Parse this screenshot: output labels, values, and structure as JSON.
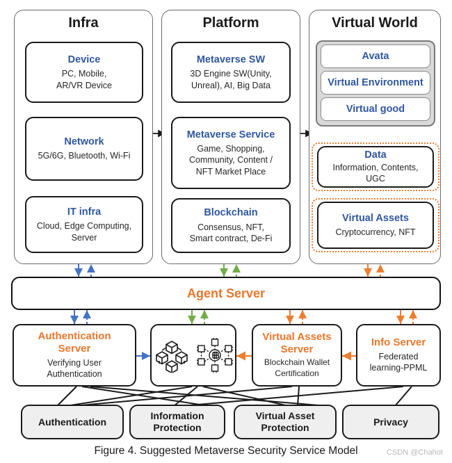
{
  "figure": {
    "caption": "Figure 4. Suggested Metaverse Security Service Model",
    "watermark": "CSDN @Chahot"
  },
  "colors": {
    "blue_heading": "#30579f",
    "orange_heading": "#e8762c",
    "orange_accent": "#ed7d31",
    "green_arrow": "#70ad47",
    "blue_arrow": "#4472c4",
    "gray_panel": "#d9d9d9",
    "gray_box": "#efefef",
    "outline": "#1a1a1a"
  },
  "columns": [
    {
      "id": "infra",
      "title": "Infra",
      "boxes": [
        {
          "title": "Device",
          "desc": "PC, Mobile,\nAR/VR Device"
        },
        {
          "title": "Network",
          "desc": "5G/6G, Bluetooth, Wi-Fi"
        },
        {
          "title": "IT infra",
          "desc": "Cloud, Edge Computing,\nServer"
        }
      ]
    },
    {
      "id": "platform",
      "title": "Platform",
      "boxes": [
        {
          "title": "Metaverse SW",
          "desc": "3D Engine SW(Unity,\nUnreal), AI, Big Data"
        },
        {
          "title": "Metaverse Service",
          "desc": "Game, Shopping,\nCommunity, Content /\nNFT Market Place"
        },
        {
          "title": "Blockchain",
          "desc": "Consensus, NFT,\nSmart contract, De-Fi"
        }
      ]
    },
    {
      "id": "virtual-world",
      "title": "Virtual World",
      "panel_items": [
        {
          "title": "Avata"
        },
        {
          "title": "Virtual Environment"
        },
        {
          "title": "Virtual good"
        }
      ],
      "boxes": [
        {
          "title": "Data",
          "desc": "Information, Contents,\nUGC",
          "dotted": true
        },
        {
          "title": "Virtual Assets",
          "desc": "Cryptocurrency, NFT",
          "dotted": true
        }
      ]
    }
  ],
  "agent_server": {
    "label": "Agent Server"
  },
  "services": [
    {
      "id": "authentication-server",
      "title": "Authentication\nServer",
      "desc": "Verifying User\nAuthentication"
    },
    {
      "id": "blockchain-icons",
      "title": "",
      "desc": "",
      "icons": [
        "block-cubes-icon",
        "bitcoin-network-icon"
      ]
    },
    {
      "id": "virtual-assets-server",
      "title": "Virtual Assets\nServer",
      "desc": "Blockchain Wallet\nCertification"
    },
    {
      "id": "info-server",
      "title": "Info Server",
      "desc": "Federated\nlearning-PPML"
    }
  ],
  "security_domains": [
    {
      "label": "Authentication"
    },
    {
      "label": "Information\nProtection"
    },
    {
      "label": "Virtual Asset\nProtection"
    },
    {
      "label": "Privacy"
    }
  ]
}
